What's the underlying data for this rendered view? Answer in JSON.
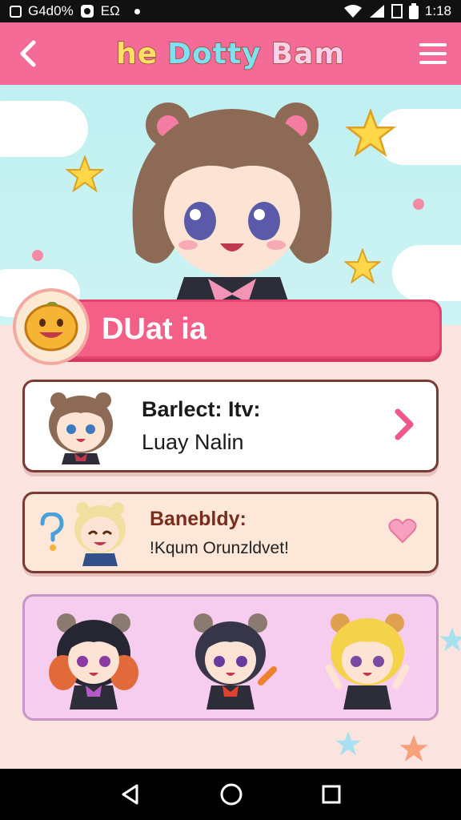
{
  "status_bar": {
    "left_text": "G4d0%",
    "left_text2": "EΩ",
    "time": "1:18"
  },
  "app_bar": {
    "title_word1": "he",
    "title_word2": "Dotty",
    "title_word3": "Bam"
  },
  "profile": {
    "name": "DUat ia"
  },
  "cards": [
    {
      "label": "Barlect: Itv:",
      "value": "Luay Nalin"
    },
    {
      "label": "Banebldy:",
      "value": "!Kqum Orunzldvet!"
    }
  ],
  "colors": {
    "accent_pink": "#f56b98",
    "banner_pink": "#f45f88",
    "card_border": "#7a3a34"
  }
}
